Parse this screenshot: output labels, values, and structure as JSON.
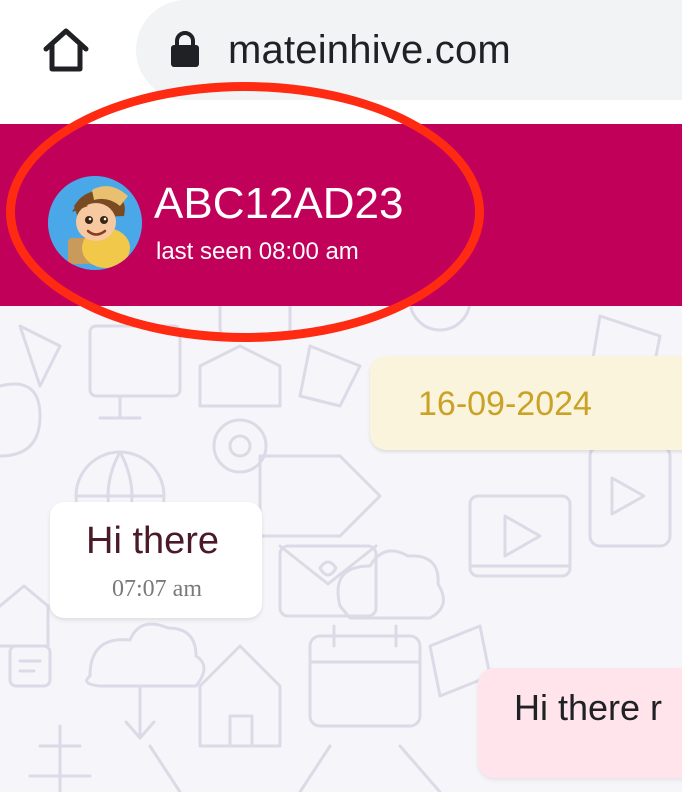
{
  "browser": {
    "url": "mateinhive.com",
    "home_icon": "home-icon",
    "lock_icon": "lock-icon",
    "pill_color": "#f1f3f4"
  },
  "chat_header": {
    "contact_name": "ABC12AD23",
    "last_seen": "last seen 08:00 am",
    "avatar": "cartoon-boy-avatar",
    "background_color": "#c1005a",
    "highlight_color": "#ff2a12"
  },
  "conversation": {
    "date_chip": "16-09-2024",
    "messages": [
      {
        "direction": "incoming",
        "text": "Hi there",
        "time": "07:07 am"
      },
      {
        "direction": "outgoing",
        "text": "Hi there r"
      }
    ],
    "incoming_bubble_color": "#ffffff",
    "outgoing_bubble_color": "#ffe4ec",
    "date_chip_color": "#fbf4dc"
  }
}
